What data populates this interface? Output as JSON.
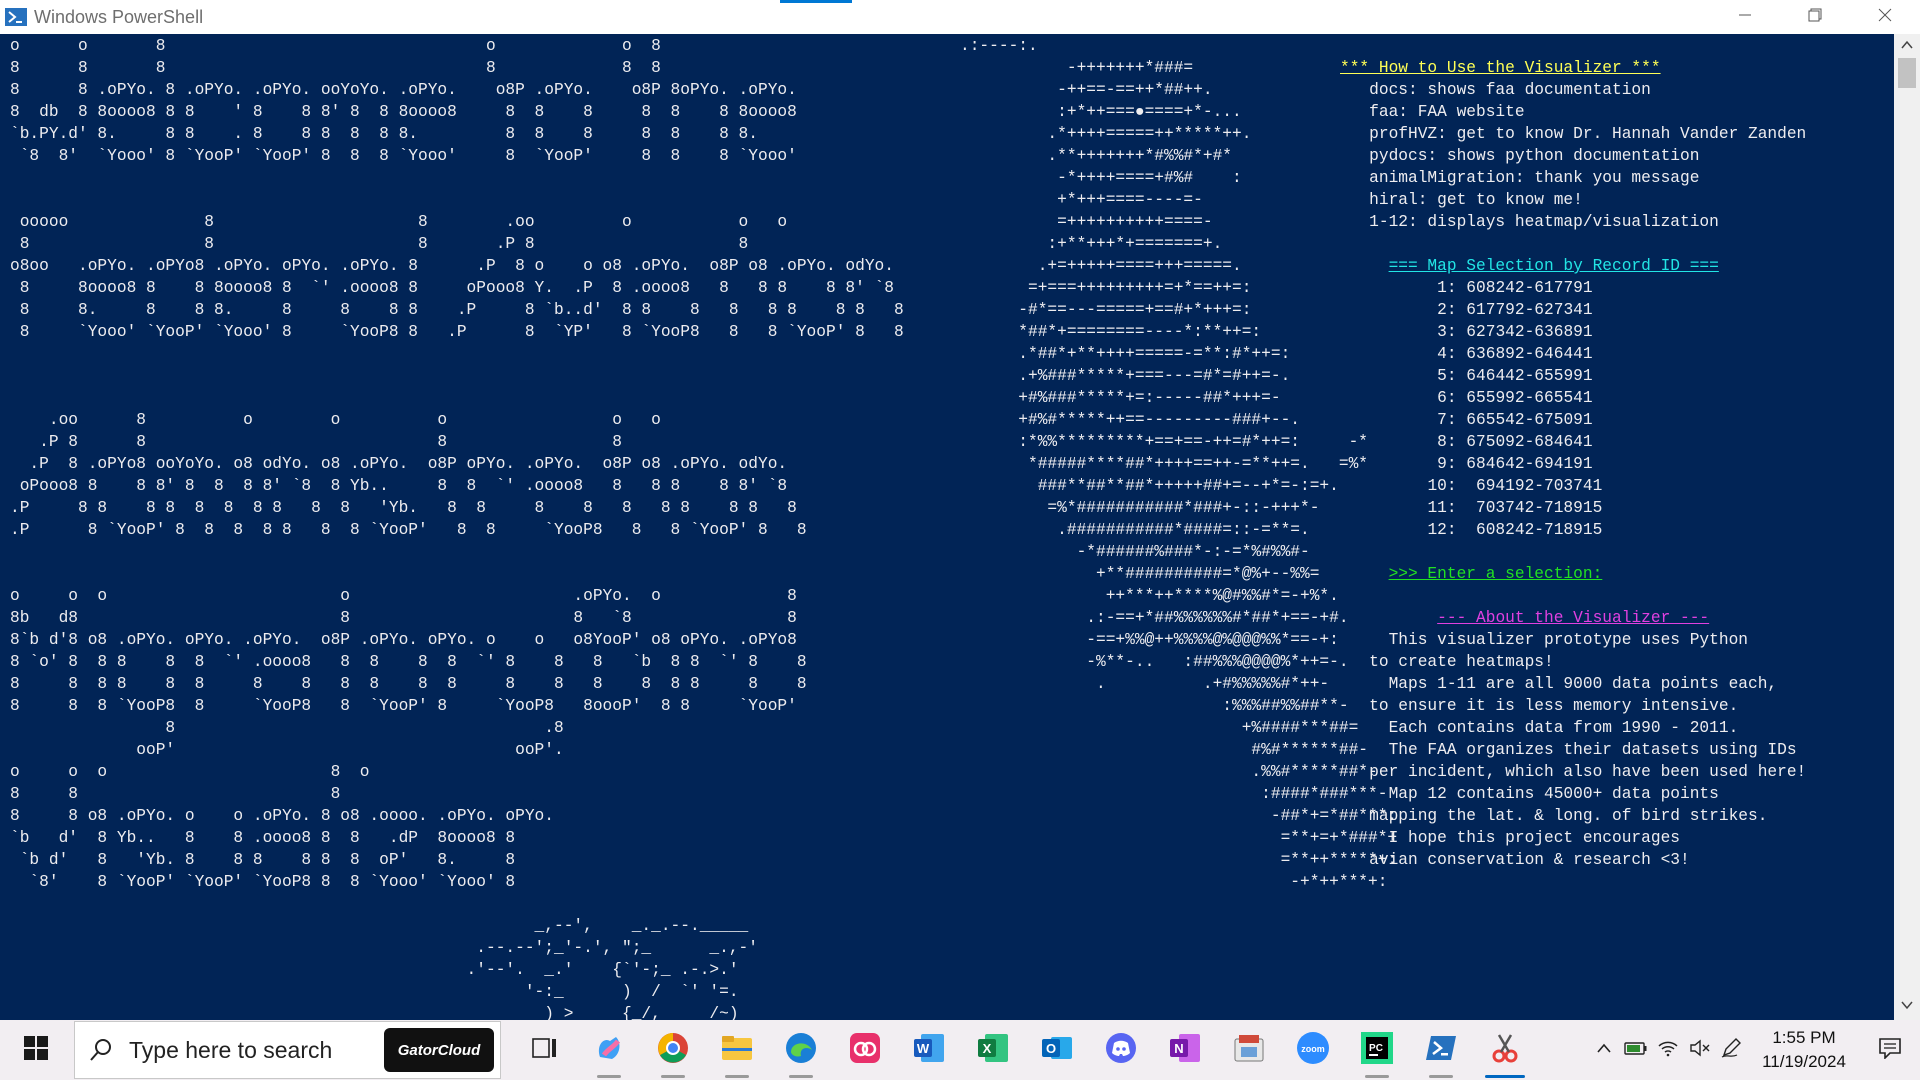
{
  "window": {
    "title": "Windows PowerShell",
    "controls": {
      "minimize_icon": "minimize-icon",
      "restore_icon": "restore-icon",
      "close_icon": "close-icon"
    }
  },
  "console": {
    "ascii_title": "o      o       8                                 o             o  8\n8      8       8                                 8             8  8\n8      8 .oPYo. 8 .oPYo. .oPYo. ooYoYo. .oPYo.    o8P .oPYo.    o8P 8oPYo. .oPYo.\n8  db  8 8oooo8 8 8    ' 8    8 8' 8  8 8oooo8     8  8    8     8  8    8 8oooo8\n`b.PY.d' 8.     8 8    . 8    8 8  8  8 8.         8  8    8     8  8    8 8.\n `8  8'  `Yooo' 8 `YooP' `YooP' 8  8  8 `Yooo'     8  `YooP'     8  8    8 `Yooo'\n\n\n ooooo              8                     8        .oo         o           o   o\n 8                  8                     8       .P 8                     8\no8oo   .oPYo. .oPYo8 .oPYo. oPYo. .oPYo. 8      .P  8 o    o o8 .oPYo.  o8P o8 .oPYo. odYo.\n 8     8oooo8 8    8 8oooo8 8  `' .oooo8 8     oPooo8 Y.  .P  8 .oooo8   8   8 8    8 8' `8\n 8     8.     8    8 8.     8     8    8 8    .P     8 `b..d'  8 8    8   8   8 8    8 8   8\n 8     `Yooo' `YooP' `Yooo' 8     `YooP8 8   .P      8  `YP'   8 `YooP8   8   8 `YooP' 8   8\n\n\n\n    .oo      8          o        o          o                 o   o\n   .P 8      8                              8                 8\n  .P  8 .oPYo8 ooYoYo. o8 odYo. o8 .oPYo.  o8P oPYo. .oPYo.  o8P o8 .oPYo. odYo.\n oPooo8 8    8 8' 8  8  8 8' `8  8 Yb..     8  8  `' .oooo8   8   8 8    8 8' `8\n.P     8 8    8 8  8  8  8 8   8  8   'Yb.   8  8     8    8   8   8 8    8 8   8\n.P      8 `YooP' 8  8  8  8 8   8  8 `YooP'   8  8     `YooP8   8   8 `YooP' 8   8\n\n\no     o  o                        o                       .oPYo.  o             8\n8b   d8                           8                       8   `8                8\n8`b d'8 o8 .oPYo. oPYo. .oPYo.  o8P .oPYo. oPYo. o    o   o8YooP' o8 oPYo. .oPYo8\n8 `o' 8  8 8    8  8  `' .oooo8   8  8    8  8  `' 8    8   8   `b  8 8  `' 8    8\n8     8  8 8    8  8     8    8   8  8    8  8     8    8   8    8  8 8     8    8\n8     8  8 `YooP8  8     `YooP8   8  `YooP' 8     `YooP8   8oooP'  8 8     `YooP'\n                8                                      .8\n             ooP'                                   ooP'.\no     o  o                       8  o\n8     8                          8\n8     8 o8 .oPYo. o    o .oPYo. 8 o8 .oooo. .oPYo. oPYo.\n`b   d'  8 Yb..   8    8 .oooo8 8  8   .dP  8oooo8 8\n `b d'   8   'Yb. 8    8 8    8 8  8  oP'   8.     8\n  `8'    8 `YooP' `YooP' `YooP8 8  8 `Yooo' `Yooo' 8\n\n                                                      _,--',    _._.--._____\n                                                .--.--';_'-.', \";_      _.,-'\n                                               .'--'.  _.'    {`'-;_ .-.>.'\n                                                     '-:_      )  /  `' '=.\n                                                       ) >     {_/,     /~)\n                                                       |/               `^ .",
    "bird_art": ".:----:.\n           -+++++++*###=\n          -++==-==++*##++.\n          :+*++===●====+*-...\n         .*++++=====++*****++.\n         .**+++++++*#%%#*+#*\n          -*++++====+#%#    :\n          +*+++====----=-\n          =++++++++++====-\n         :+**+++*+=======+.\n        .+=+++++====+++=====.\n       =+===+++++++++=+*==++=:\n      -#*==---=====+==#+*+++=:\n      *##*+========----*:**++=:\n      .*##*+**++++=====-=**:#*++=:\n      .+%###*****+===---=#*=#++=-.\n      +#%###*****+=:-----##*+++=-\n      +#%#*****++==---------###+--.\n      :*%%*********+==+==-++=#*++=:     -*\n       *#####****##*++++==++-=**++=.   =%*\n        ###**##**##*+++++##+=--+*=-:=+.\n         =%*###########*###+-::-+++*-\n          .###########*####=::-=**=.\n            -*######%###*-:-=*%#%%#-\n              +**##########=*@%+--%%=\n               ++***++****%@#%%#*=-+%*.\n             .:-==+*##%%%%%%#*##*+==-+#.\n             -==+%%@++%%%%@%@@@%%*==-+:\n             -%**-..   :##%%%@@@@%*++=-.\n              .          .+#%%%%%#*++-\n                           :%%%##%%##**-\n                             +%####***##=\n                              #%#******##-\n                              .%%#*****##*-\n                               :####*###***-\n                                -##*+=*##***:\n                                 =**+=+*###*+\n                                 =**++*****+:\n                                  -+*++***+:"
  },
  "menu": {
    "howto_title": "*** How to Use the Visualizer ***",
    "howto_lines": [
      "   docs: shows faa documentation",
      "   faa: FAA website",
      "   profHVZ: get to know Dr. Hannah Vander Zanden",
      "   pydocs: shows python documentation",
      "   animalMigration: thank you message",
      "   hiral: get to know me!",
      "   1-12: displays heatmap/visualization"
    ],
    "map_title": "=== Map Selection by Record ID ===",
    "map_items": [
      "1: 608242-617791",
      "2: 617792-627341",
      "3: 627342-636891",
      "4: 636892-646441",
      "5: 646442-655991",
      "6: 655992-665541",
      "7: 665542-675091",
      "8: 675092-684641",
      "9: 684642-694191",
      "10:  694192-703741",
      "11:  703742-718915",
      "12:  608242-718915"
    ],
    "prompt": ">>> Enter a selection:",
    "about_title": "--- About the Visualizer ---",
    "about_lines": [
      "     This visualizer prototype uses Python",
      "   to create heatmaps!",
      "     Maps 1-11 are all 9000 data points each,",
      "   to ensure it is less memory intensive.",
      "     Each contains data from 1990 - 2011.",
      "     The FAA organizes their datasets using IDs",
      "   per incident, which also have been used here!",
      "     Map 12 contains 45000+ data points",
      "   mapping the lat. & long. of bird strikes.",
      "     I hope this project encourages",
      "   avian conservation & research <3!"
    ]
  },
  "taskbar": {
    "search_placeholder": "Type here to search",
    "search_badge": "GatorCloud",
    "pinned": [
      "task-view-icon",
      "copilot-icon",
      "chrome-icon",
      "file-explorer-icon",
      "edge-icon",
      "creative-cloud-icon",
      "word-icon",
      "excel-icon",
      "outlook-icon",
      "discord-icon",
      "onenote-icon",
      "app-icon",
      "zoom-icon",
      "pycharm-icon",
      "powershell-icon",
      "snipping-tool-icon"
    ],
    "time": "1:55 PM",
    "date": "11/19/2024"
  },
  "colors": {
    "console_bg": "#012456",
    "console_text": "#eeedf0",
    "yellow": "#ffff55",
    "cyan": "#22e5e5",
    "green": "#22e022",
    "magenta": "#e040e0"
  }
}
